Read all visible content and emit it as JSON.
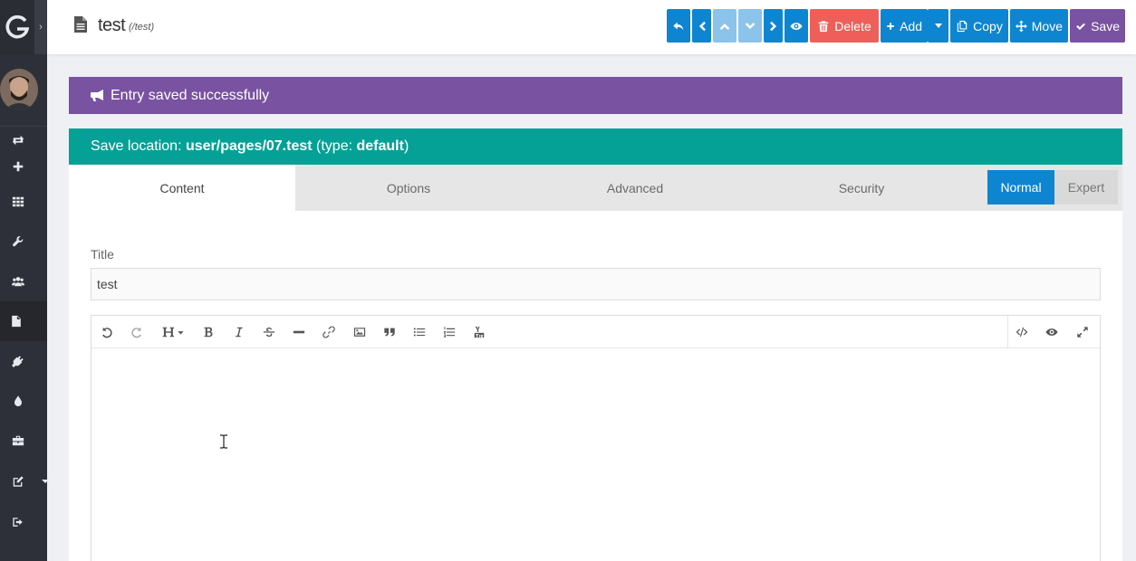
{
  "sidebar": {
    "logo_letter": "G",
    "expand_glyph": "›",
    "items": [
      {
        "icon": "refresh-icon"
      },
      {
        "icon": "plus-icon"
      },
      {
        "icon": "grid-icon"
      },
      {
        "icon": "wrench-icon"
      },
      {
        "icon": "users-icon"
      },
      {
        "icon": "file-icon",
        "active": true
      },
      {
        "icon": "plug-icon"
      },
      {
        "icon": "drop-icon"
      },
      {
        "icon": "briefcase-icon"
      },
      {
        "icon": "edit-icon"
      },
      {
        "icon": "logout-icon"
      }
    ]
  },
  "header": {
    "title": "test",
    "route": "(/test)"
  },
  "toolbar": {
    "delete_label": "Delete",
    "add_label": "Add",
    "copy_label": "Copy",
    "move_label": "Move",
    "save_label": "Save"
  },
  "notice": {
    "message": "Entry saved successfully"
  },
  "location": {
    "prefix": "Save location: ",
    "path": "user/pages/07.test",
    "type_prefix": " (type: ",
    "type": "default",
    "suffix": ")"
  },
  "tabs": [
    "Content",
    "Options",
    "Advanced",
    "Security"
  ],
  "mode": {
    "normal_label": "Normal",
    "expert_label": "Expert"
  },
  "form": {
    "title_label": "Title",
    "title_value": "test"
  },
  "colors": {
    "sidebar": "#2d3038",
    "primary": "#0e85d1",
    "danger": "#ef5f5a",
    "purple": "#7952a1",
    "teal": "#05a196"
  }
}
